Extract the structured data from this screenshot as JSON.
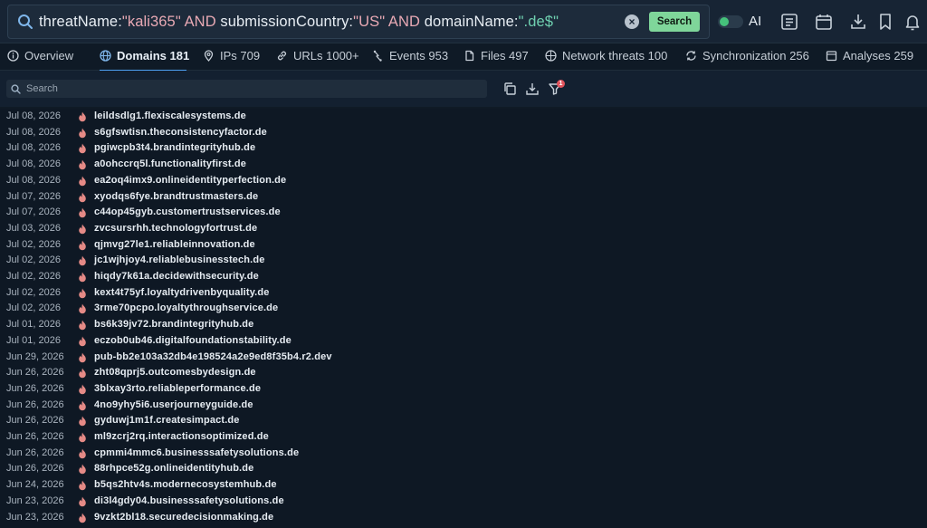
{
  "query": {
    "parts": [
      {
        "t": "threatName:",
        "c": "field"
      },
      {
        "t": "\"kali365\"",
        "c": "str"
      },
      {
        "t": " AND ",
        "c": "op"
      },
      {
        "t": "submissionCountry:",
        "c": "field"
      },
      {
        "t": "\"US\"",
        "c": "str"
      },
      {
        "t": " AND ",
        "c": "op"
      },
      {
        "t": "domainName:",
        "c": "field"
      },
      {
        "t": "\".de$\"",
        "c": "regex"
      }
    ],
    "search_label": "Search",
    "ai_label": "AI",
    "ai_enabled": true
  },
  "tabs": [
    {
      "label": "Overview",
      "icon": "info-icon",
      "active": false
    },
    {
      "label": "Domains 181",
      "icon": "globe-icon",
      "active": true
    },
    {
      "label": "IPs 709",
      "icon": "pin-icon",
      "active": false
    },
    {
      "label": "URLs 1000+",
      "icon": "link-icon",
      "active": false
    },
    {
      "label": "Events 953",
      "icon": "bolt-icon",
      "active": false
    },
    {
      "label": "Files 497",
      "icon": "file-icon",
      "active": false
    },
    {
      "label": "Network threats 100",
      "icon": "network-icon",
      "active": false
    },
    {
      "label": "Synchronization 256",
      "icon": "sync-icon",
      "active": false
    },
    {
      "label": "Analyses 259",
      "icon": "analyses-icon",
      "active": false
    }
  ],
  "filter": {
    "placeholder": "Search",
    "filter_badge": "1"
  },
  "rows": [
    {
      "date": "Jul 08, 2026",
      "domain": "leildsdlg1.flexiscalesystems.de"
    },
    {
      "date": "Jul 08, 2026",
      "domain": "s6gfswtisn.theconsistencyfactor.de"
    },
    {
      "date": "Jul 08, 2026",
      "domain": "pgiwcpb3t4.brandintegrityhub.de"
    },
    {
      "date": "Jul 08, 2026",
      "domain": "a0ohccrq5l.functionalityfirst.de"
    },
    {
      "date": "Jul 08, 2026",
      "domain": "ea2oq4imx9.onlineidentityperfection.de"
    },
    {
      "date": "Jul 07, 2026",
      "domain": "xyodqs6fye.brandtrustmasters.de"
    },
    {
      "date": "Jul 07, 2026",
      "domain": "c44op45gyb.customertrustservices.de"
    },
    {
      "date": "Jul 03, 2026",
      "domain": "zvcsursrhh.technologyfortrust.de"
    },
    {
      "date": "Jul 02, 2026",
      "domain": "qjmvg27le1.reliableinnovation.de"
    },
    {
      "date": "Jul 02, 2026",
      "domain": "jc1wjhjoy4.reliablebusinesstech.de"
    },
    {
      "date": "Jul 02, 2026",
      "domain": "hiqdy7k61a.decidewithsecurity.de"
    },
    {
      "date": "Jul 02, 2026",
      "domain": "kext4t75yf.loyaltydrivenbyquality.de"
    },
    {
      "date": "Jul 02, 2026",
      "domain": "3rme70pcpo.loyaltythroughservice.de"
    },
    {
      "date": "Jul 01, 2026",
      "domain": "bs6k39jv72.brandintegrityhub.de"
    },
    {
      "date": "Jul 01, 2026",
      "domain": "eczob0ub46.digitalfoundationstability.de"
    },
    {
      "date": "Jun 29, 2026",
      "domain": "pub-bb2e103a32db4e198524a2e9ed8f35b4.r2.dev"
    },
    {
      "date": "Jun 26, 2026",
      "domain": "zht08qprj5.outcomesbydesign.de"
    },
    {
      "date": "Jun 26, 2026",
      "domain": "3blxay3rto.reliableperformance.de"
    },
    {
      "date": "Jun 26, 2026",
      "domain": "4no9yhy5i6.userjourneyguide.de"
    },
    {
      "date": "Jun 26, 2026",
      "domain": "gyduwj1m1f.createsimpact.de"
    },
    {
      "date": "Jun 26, 2026",
      "domain": "ml9zcrj2rq.interactionsoptimized.de"
    },
    {
      "date": "Jun 26, 2026",
      "domain": "cpmmi4mmc6.businesssafetysolutions.de"
    },
    {
      "date": "Jun 26, 2026",
      "domain": "88rhpce52g.onlineidentityhub.de"
    },
    {
      "date": "Jun 24, 2026",
      "domain": "b5qs2htv4s.modernecosystemhub.de"
    },
    {
      "date": "Jun 23, 2026",
      "domain": "di3l4gdy04.businesssafetysolutions.de"
    },
    {
      "date": "Jun 23, 2026",
      "domain": "9vzkt2bl18.securedecisionmaking.de"
    }
  ]
}
